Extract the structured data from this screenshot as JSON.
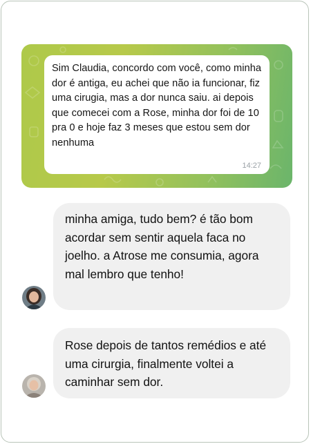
{
  "telegram_message": {
    "text": "Sim Claudia, concordo com você, como minha dor é antiga, eu achei que não ia funcionar, fiz uma cirugia, mas a dor nunca saiu. ai depois que comecei com a Rose, minha dor foi de 10 pra 0 e hoje faz 3 meses que estou sem dor nenhuma",
    "time": "14:27"
  },
  "comments": [
    {
      "text": "minha amiga, tudo bem?  é tão bom acordar sem sentir aquela faca no joelho. a Atrose me consumia, agora mal lembro que tenho!"
    },
    {
      "text": "Rose depois de tantos remédios e até uma cirurgia, finalmente voltei a caminhar sem dor."
    }
  ],
  "colors": {
    "panel_gradient_start": "#aec94a",
    "panel_gradient_end": "#6bb56b",
    "comment_bubble": "#f0f0f0"
  }
}
